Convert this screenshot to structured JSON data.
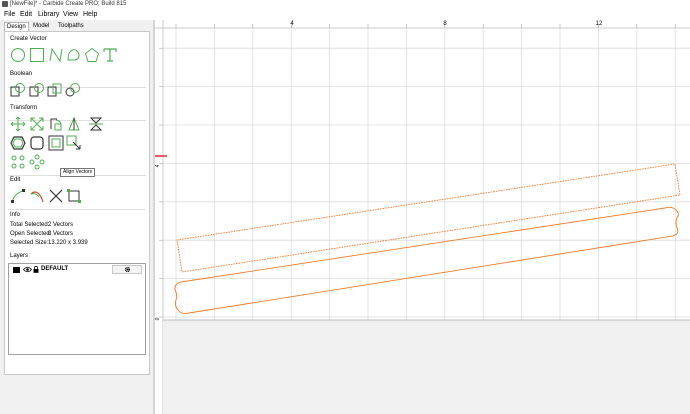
{
  "window": {
    "title": "[NewFile]* - Carbide Create PRO; Build 815"
  },
  "menu": [
    "File",
    "Edit",
    "Library",
    "View",
    "Help"
  ],
  "tabs": [
    "Design",
    "Model",
    "Toolpaths"
  ],
  "sections": {
    "create_vector": "Create Vector",
    "boolean": "Boolean",
    "transform": "Transform",
    "edit": "Edit",
    "info": "Info",
    "layers": "Layers"
  },
  "info": {
    "total_selected_label": "Total Selected:",
    "total_selected_value": "2 Vectors",
    "open_selected_label": "Open Selected:",
    "open_selected_value": "0 Vectors",
    "selected_size_label": "Selected Size:",
    "selected_size_value": "13.220 x 3.939"
  },
  "layers": [
    {
      "name": "DEFAULT",
      "color": "#000000"
    }
  ],
  "tooltip": "Align Vectors",
  "ruler": {
    "top_ticks": [
      "4",
      "8",
      "12"
    ],
    "left_ticks": [
      "4",
      "0"
    ]
  },
  "colors": {
    "accent": "#4caf50",
    "vector": "#f07b2a",
    "grid": "#dcdcdc",
    "axis": "#e03030"
  },
  "icons": {
    "create": [
      "circle-icon",
      "rectangle-icon",
      "polyline-icon",
      "curve-icon",
      "polygon-icon",
      "text-icon"
    ],
    "boolean": [
      "union-icon",
      "subtract-icon",
      "intersect-icon",
      "weld-icon"
    ],
    "transform": [
      "move-icon",
      "scale-icon",
      "rotate-icon",
      "mirror-icon",
      "offset-icon",
      "fillet-icon",
      "group-icon",
      "align-icon",
      "array-circle-icon",
      "array-grid-icon"
    ],
    "edit": [
      "node-edit-icon",
      "trim-icon",
      "cut-icon",
      "join-icon"
    ]
  }
}
